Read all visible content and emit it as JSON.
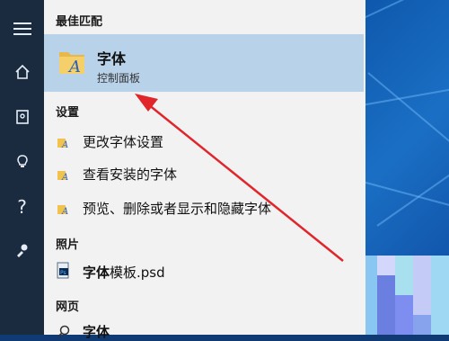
{
  "sections": {
    "best_match": "最佳匹配",
    "settings": "设置",
    "photos": "照片",
    "web": "网页"
  },
  "best_match_item": {
    "title": "字体",
    "subtitle": "控制面板",
    "icon": "font-folder-icon"
  },
  "settings_items": [
    {
      "label": "更改字体设置",
      "icon": "font-settings-icon"
    },
    {
      "label": "查看安装的字体",
      "icon": "font-settings-icon"
    },
    {
      "label": "预览、删除或者显示和隐藏字体",
      "icon": "font-settings-icon"
    }
  ],
  "photo_item": {
    "bold_part": "字体",
    "rest": "模板.psd",
    "icon": "psd-file-icon"
  },
  "web_item": {
    "label": "字体",
    "icon": "search-icon"
  },
  "rail_icons": [
    "hamburger-menu-icon",
    "home-icon",
    "notebook-icon",
    "lightbulb-icon",
    "help-icon",
    "feedback-icon"
  ],
  "colors": {
    "panel_bg": "#f2f2f2",
    "best_match_highlight": "#b8d2ea",
    "rail_bg": "#1a2b40",
    "arrow": "#e0262a"
  }
}
